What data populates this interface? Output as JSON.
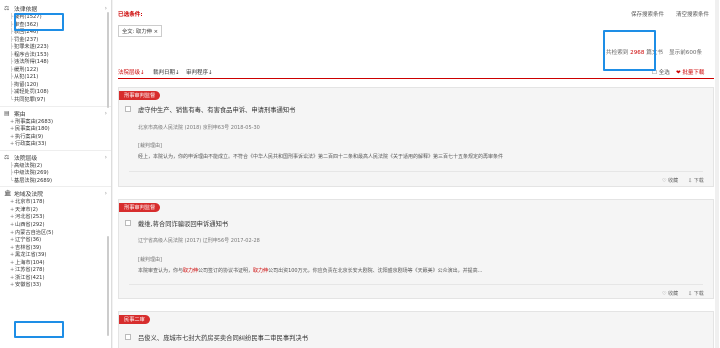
{
  "sidebar": {
    "section1": {
      "label": "法律依据",
      "items": [
        {
          "label": "裁判(1527)"
        },
        {
          "label": "审查(362)"
        },
        {
          "label": "驳回(246)"
        },
        {
          "label": "罚金(237)"
        },
        {
          "label": "犯罪未遂(223)"
        },
        {
          "label": "程序合法(153)"
        },
        {
          "label": "违法所得(148)"
        },
        {
          "label": "缓刑(122)"
        },
        {
          "label": "从犯(121)"
        },
        {
          "label": "拘留(120)"
        },
        {
          "label": "减轻处罚(108)"
        },
        {
          "label": "共同犯罪(97)"
        }
      ]
    },
    "section2": {
      "label": "案由",
      "items": [
        {
          "label": "刑事案由(2683)"
        },
        {
          "label": "民事案由(180)"
        },
        {
          "label": "执行案由(9)"
        },
        {
          "label": "行政案由(33)"
        }
      ]
    },
    "section3": {
      "label": "法院层级",
      "items": [
        {
          "label": "高级法院(2)"
        },
        {
          "label": "中级法院(269)"
        },
        {
          "label": "基层法院(2689)"
        }
      ]
    },
    "section4": {
      "label": "地域及法院",
      "items": [
        {
          "label": "北京市(178)"
        },
        {
          "label": "天津市(2)"
        },
        {
          "label": "河北省(253)"
        },
        {
          "label": "山西省(292)"
        },
        {
          "label": "内蒙古自治区(5)"
        },
        {
          "label": "辽宁省(36)"
        },
        {
          "label": "吉林省(39)"
        },
        {
          "label": "黑龙江省(39)"
        },
        {
          "label": "上海市(104)"
        },
        {
          "label": "江苏省(278)"
        },
        {
          "label": "浙江省(421)"
        },
        {
          "label": "安徽省(33)"
        }
      ]
    }
  },
  "main": {
    "conditions_label": "已选条件:",
    "condition_tag": "全文: 取力伸 ×",
    "save_search": "保存搜索条件",
    "clear_search": "清空搜索条件",
    "results": {
      "prefix": "共检索到",
      "count": "2968",
      "suffix": "篇文书",
      "display": "显示前600条"
    },
    "sort": {
      "relevance": "法院层级↓",
      "date": "裁判日期↓",
      "procedure": "审判程序↓",
      "select_all": "全选",
      "batch_download": "批量下载"
    },
    "cards": [
      {
        "tag": "刑事审判监督",
        "title": "虚守仲生产、销售有毒、有害食品申诉、申请刑事通知书",
        "meta": "北京市高级人民法院    (2018) 京刑申63号    2018-05-30",
        "reason_label": "[裁判理由]",
        "reason": "经上，本院认为，你的申诉理由不能成立。不符合《中华人民共和国刑事诉讼法》第二百四十二条和最高人民法院《关于适用的解释》第三百七十五条规定的再审条件",
        "collect": "♡ 收藏",
        "download": "⇩ 下载"
      },
      {
        "tag": "刑事审判监督",
        "title": "戴维,蒋合同诈骗驳回申诉通知书",
        "meta": "辽宁省高级人民法院    (2017) 辽刑申56号    2017-02-28",
        "reason_label": "[裁判理由]",
        "reason_a": "本院审查认为，你与",
        "reason_kw1": "取力伸",
        "reason_b": "公司签订的协议书证明，",
        "reason_kw2": "取力伸",
        "reason_c": "公司出资100万元，你应负责在北京长安大剧院、沈阳盛京剧场等《天籁美》公众演出，并提高...",
        "collect": "♡ 收藏",
        "download": "⇩ 下载"
      },
      {
        "tag": "民事二审",
        "title": "吕俊义、庞城市七封大药房买卖合同纠纷民事二审民事判决书"
      }
    ]
  }
}
